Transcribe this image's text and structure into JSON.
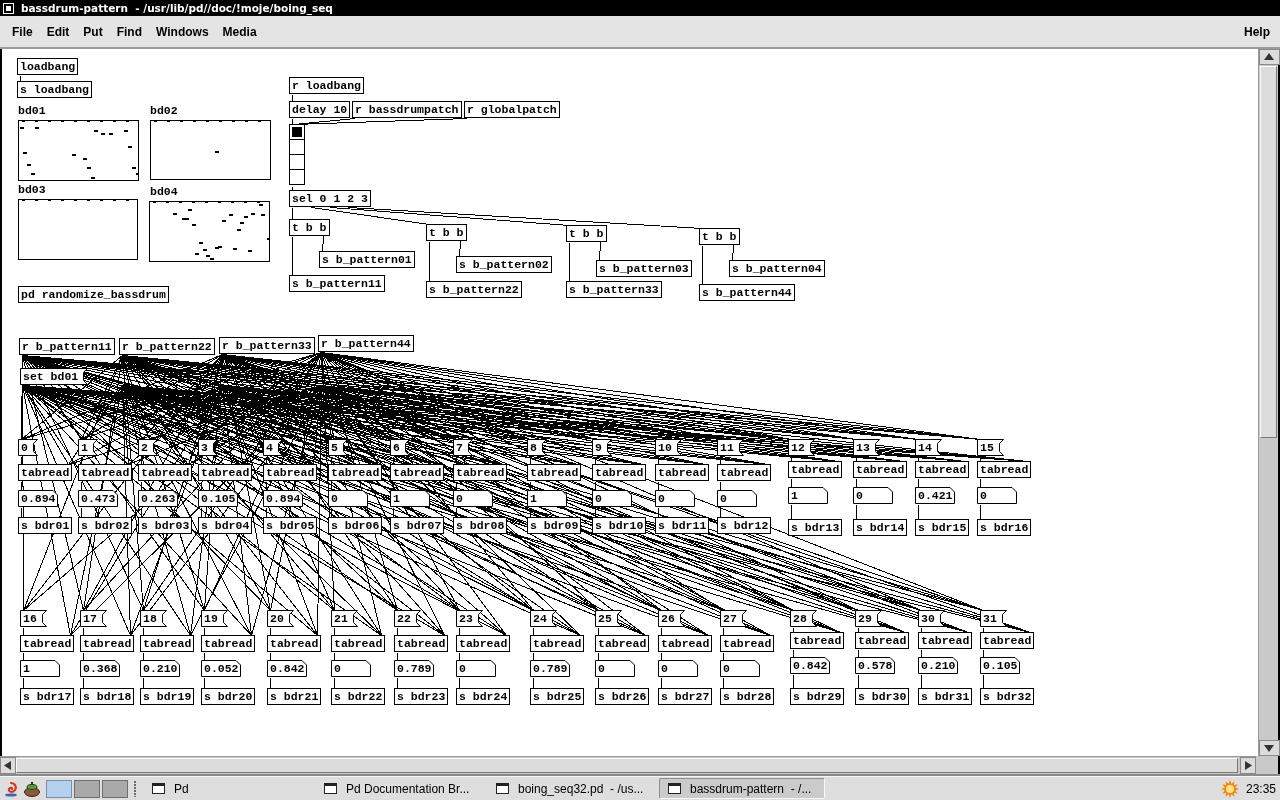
{
  "window": {
    "title": "bassdrum-pattern  - /usr/lib/pd//doc/!moje/boing_seq"
  },
  "menu_bar": {
    "items": [
      "File",
      "Edit",
      "Put",
      "Find",
      "Windows",
      "Media"
    ],
    "help": "Help"
  },
  "patch": {
    "objects": [
      {
        "kind": "object",
        "text": "loadbang"
      },
      {
        "kind": "object",
        "text": "s loadbang"
      },
      {
        "kind": "object",
        "text": "r loadbang"
      },
      {
        "kind": "object",
        "text": "delay 10"
      },
      {
        "kind": "object",
        "text": "r bassdrumpatch"
      },
      {
        "kind": "object",
        "text": "r globalpatch"
      },
      {
        "kind": "object",
        "text": "sel 0 1 2 3"
      },
      {
        "kind": "object",
        "text": "t b b"
      },
      {
        "kind": "object",
        "text": "t b b"
      },
      {
        "kind": "object",
        "text": "t b b"
      },
      {
        "kind": "object",
        "text": "t b b"
      },
      {
        "kind": "object",
        "text": "s b_pattern01"
      },
      {
        "kind": "object",
        "text": "s b_pattern02"
      },
      {
        "kind": "object",
        "text": "s b_pattern03"
      },
      {
        "kind": "object",
        "text": "s b_pattern04"
      },
      {
        "kind": "object",
        "text": "pd randomize_bassdrum"
      },
      {
        "kind": "object",
        "text": "s b_pattern11"
      },
      {
        "kind": "object",
        "text": "s b_pattern22"
      },
      {
        "kind": "object",
        "text": "s b_pattern33"
      },
      {
        "kind": "object",
        "text": "s b_pattern44"
      },
      {
        "kind": "object",
        "text": "r b_pattern11"
      },
      {
        "kind": "object",
        "text": "r b_pattern22"
      },
      {
        "kind": "object",
        "text": "r b_pattern33"
      },
      {
        "kind": "object",
        "text": "r b_pattern44"
      },
      {
        "kind": "message",
        "text": "set bd01"
      }
    ],
    "arrays": [
      {
        "name": "bd01"
      },
      {
        "name": "bd02"
      },
      {
        "name": "bd03"
      },
      {
        "name": "bd04"
      }
    ],
    "radio": {
      "cells": [
        {
          "selected": true
        },
        {
          "selected": false
        },
        {
          "selected": false
        },
        {
          "selected": false
        }
      ]
    },
    "step_rows": [
      {
        "steps": [
          {
            "index": "0",
            "reader": "tabread",
            "value": "0.894",
            "send": "s bdr01"
          },
          {
            "index": "1",
            "reader": "tabread",
            "value": "0.473",
            "send": "s bdr02"
          },
          {
            "index": "2",
            "reader": "tabread",
            "value": "0.263",
            "send": "s bdr03"
          },
          {
            "index": "3",
            "reader": "tabread",
            "value": "0.105",
            "send": "s bdr04"
          },
          {
            "index": "4",
            "reader": "tabread",
            "value": "0.894",
            "send": "s bdr05"
          },
          {
            "index": "5",
            "reader": "tabread",
            "value": "0",
            "send": "s bdr06"
          },
          {
            "index": "6",
            "reader": "tabread",
            "value": "1",
            "send": "s bdr07"
          },
          {
            "index": "7",
            "reader": "tabread",
            "value": "0",
            "send": "s bdr08"
          },
          {
            "index": "8",
            "reader": "tabread",
            "value": "1",
            "send": "s bdr09"
          },
          {
            "index": "9",
            "reader": "tabread",
            "value": "0",
            "send": "s bdr10"
          },
          {
            "index": "10",
            "reader": "tabread",
            "value": "0",
            "send": "s bdr11"
          },
          {
            "index": "11",
            "reader": "tabread",
            "value": "0",
            "send": "s bdr12"
          },
          {
            "index": "12",
            "reader": "tabread",
            "value": "1",
            "send": "s bdr13"
          },
          {
            "index": "13",
            "reader": "tabread",
            "value": "0",
            "send": "s bdr14"
          },
          {
            "index": "14",
            "reader": "tabread",
            "value": "0.421",
            "send": "s bdr15"
          },
          {
            "index": "15",
            "reader": "tabread",
            "value": "0",
            "send": "s bdr16"
          }
        ]
      },
      {
        "steps": [
          {
            "index": "16",
            "reader": "tabread",
            "value": "1",
            "send": "s bdr17"
          },
          {
            "index": "17",
            "reader": "tabread",
            "value": "0.368",
            "send": "s bdr18"
          },
          {
            "index": "18",
            "reader": "tabread",
            "value": "0.210",
            "send": "s bdr19"
          },
          {
            "index": "19",
            "reader": "tabread",
            "value": "0.052",
            "send": "s bdr20"
          },
          {
            "index": "20",
            "reader": "tabread",
            "value": "0.842",
            "send": "s bdr21"
          },
          {
            "index": "21",
            "reader": "tabread",
            "value": "0",
            "send": "s bdr22"
          },
          {
            "index": "22",
            "reader": "tabread",
            "value": "0.789",
            "send": "s bdr23"
          },
          {
            "index": "23",
            "reader": "tabread",
            "value": "0",
            "send": "s bdr24"
          },
          {
            "index": "24",
            "reader": "tabread",
            "value": "0.789",
            "send": "s bdr25"
          },
          {
            "index": "25",
            "reader": "tabread",
            "value": "0",
            "send": "s bdr26"
          },
          {
            "index": "26",
            "reader": "tabread",
            "value": "0",
            "send": "s bdr27"
          },
          {
            "index": "27",
            "reader": "tabread",
            "value": "0",
            "send": "s bdr28"
          },
          {
            "index": "28",
            "reader": "tabread",
            "value": "0.842",
            "send": "s bdr29"
          },
          {
            "index": "29",
            "reader": "tabread",
            "value": "0.578",
            "send": "s bdr30"
          },
          {
            "index": "30",
            "reader": "tabread",
            "value": "0.210",
            "send": "s bdr31"
          },
          {
            "index": "31",
            "reader": "tabread",
            "value": "0.105",
            "send": "s bdr32"
          }
        ]
      }
    ]
  },
  "taskbar": {
    "workspaces": [
      {
        "selected": true
      },
      {
        "selected": false
      },
      {
        "selected": false
      }
    ],
    "tasks": [
      {
        "label": "Pd",
        "selected": false
      },
      {
        "label": "Pd Documentation Br...",
        "selected": false
      },
      {
        "label": "boing_seq32.pd  - /us...",
        "selected": false
      },
      {
        "label": "bassdrum-pattern  - /...",
        "selected": true
      }
    ],
    "clock": "23:35"
  }
}
